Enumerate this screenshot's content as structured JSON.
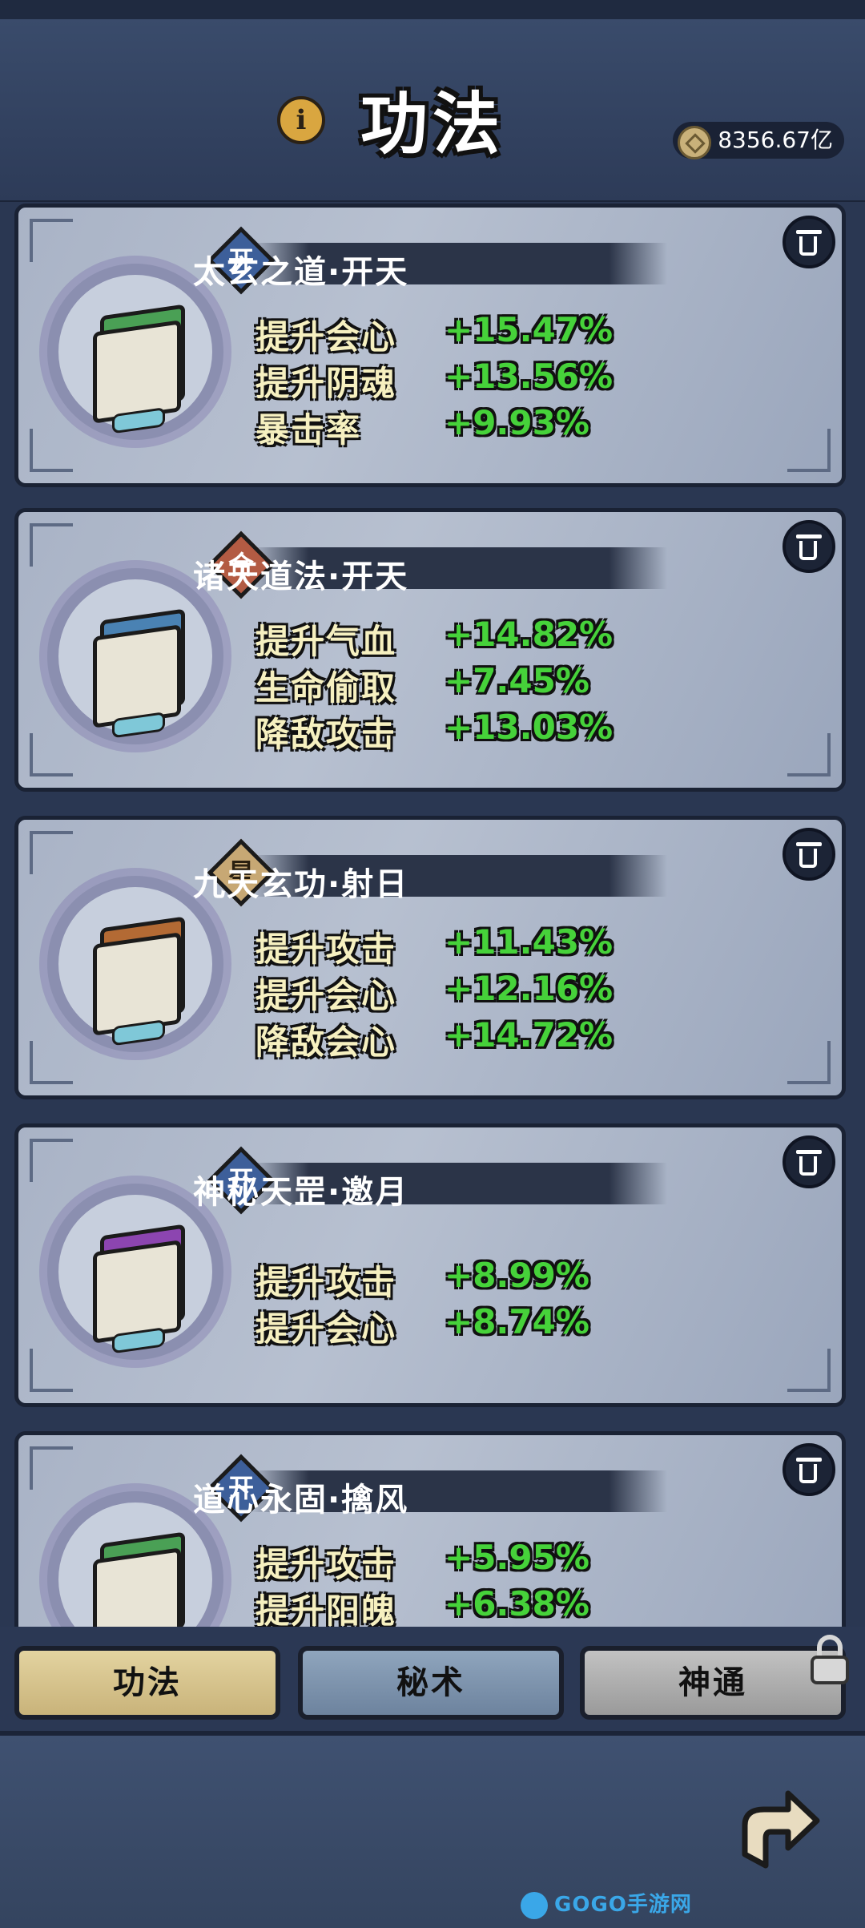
{
  "header": {
    "title": "功法",
    "info_icon": "i",
    "currency_value": "8356.67亿"
  },
  "cards": [
    {
      "badge": "开",
      "badge_type": "kai",
      "book_color": "#4aa055",
      "name": "太玄之道·开天",
      "stats": [
        {
          "label": "提升会心",
          "value": "+15.47%"
        },
        {
          "label": "提升阴魂",
          "value": "+13.56%"
        },
        {
          "label": "暴击率",
          "value": "+9.93%"
        }
      ]
    },
    {
      "badge": "合",
      "badge_type": "he",
      "book_color": "#4a82b3",
      "name": "诸天道法·开天",
      "stats": [
        {
          "label": "提升气血",
          "value": "+14.82%"
        },
        {
          "label": "生命偷取",
          "value": "+7.45%"
        },
        {
          "label": "降敌攻击",
          "value": "+13.03%"
        }
      ]
    },
    {
      "badge": "星",
      "badge_type": "xing",
      "book_color": "#b36a34",
      "name": "九天玄功·射日",
      "stats": [
        {
          "label": "提升攻击",
          "value": "+11.43%"
        },
        {
          "label": "提升会心",
          "value": "+12.16%"
        },
        {
          "label": "降敌会心",
          "value": "+14.72%"
        }
      ]
    },
    {
      "badge": "开",
      "badge_type": "kai",
      "book_color": "#8c45b0",
      "name": "神秘天罡·邀月",
      "stats": [
        {
          "label": "提升攻击",
          "value": "+8.99%"
        },
        {
          "label": "提升会心",
          "value": "+8.74%"
        }
      ]
    },
    {
      "badge": "开",
      "badge_type": "kai",
      "book_color": "#4aa055",
      "name": "道心永固·擒风",
      "stats": [
        {
          "label": "提升攻击",
          "value": "+5.95%"
        },
        {
          "label": "提升阳魄",
          "value": "+6.38%"
        }
      ]
    }
  ],
  "tabs": [
    {
      "label": "功法",
      "active": true
    },
    {
      "label": "秘术",
      "active": false
    },
    {
      "label": "神通",
      "active": false,
      "locked": true
    }
  ],
  "icons": {
    "delete": "trash-icon",
    "currency": "coin-icon",
    "back": "back-arrow-icon",
    "lock": "lock-icon"
  },
  "watermark": "GOGO手游网"
}
